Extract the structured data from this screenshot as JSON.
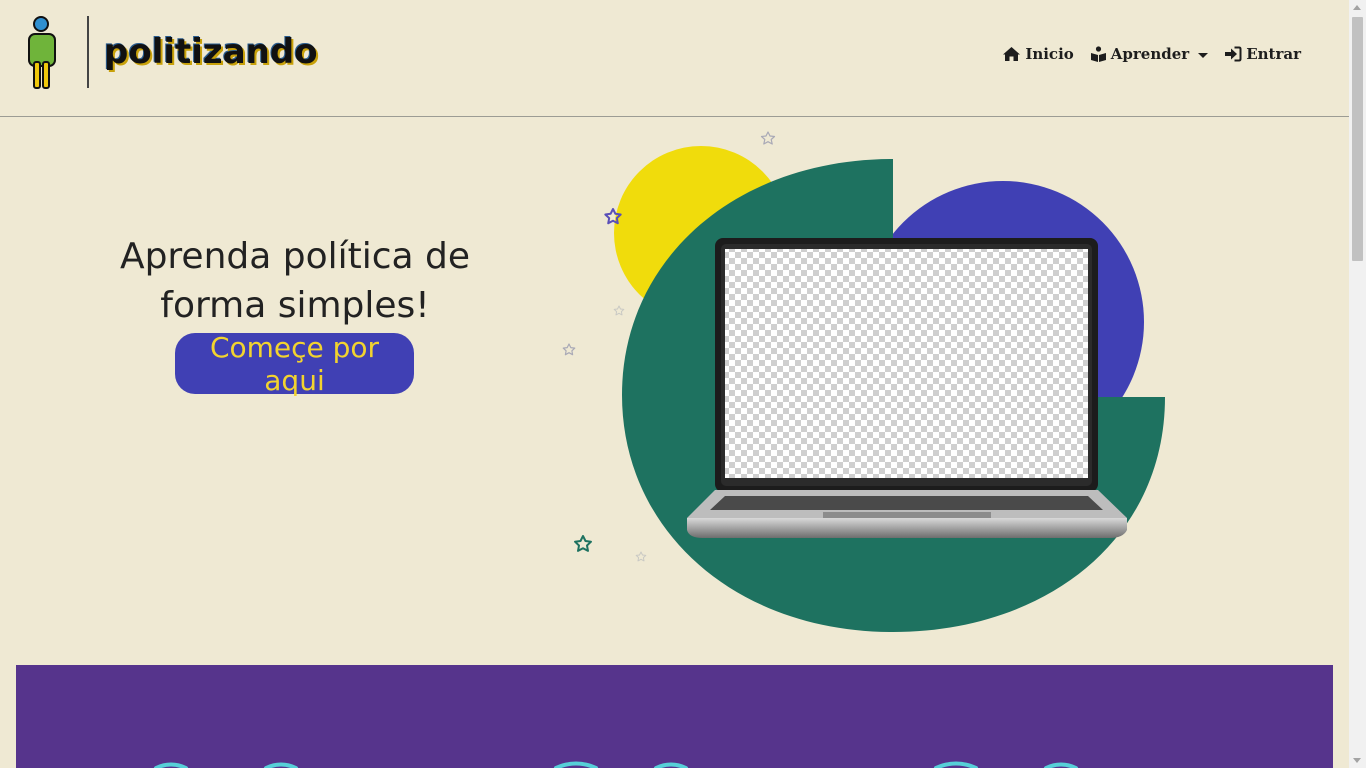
{
  "brand": {
    "name": "politizando"
  },
  "nav": {
    "items": [
      {
        "label": "Inicio",
        "icon": "home-icon"
      },
      {
        "label": "Aprender",
        "icon": "book-reader-icon",
        "dropdown": true
      },
      {
        "label": "Entrar",
        "icon": "sign-in-icon"
      }
    ]
  },
  "hero": {
    "title": "Aprenda política de forma simples!",
    "cta_label": "Começe por aqui"
  },
  "colors": {
    "background": "#efe9d3",
    "green": "#1e7260",
    "yellow": "#f0dc0c",
    "blue": "#4040b4",
    "purple_band": "#56348c",
    "cta_text": "#f2d32f"
  }
}
